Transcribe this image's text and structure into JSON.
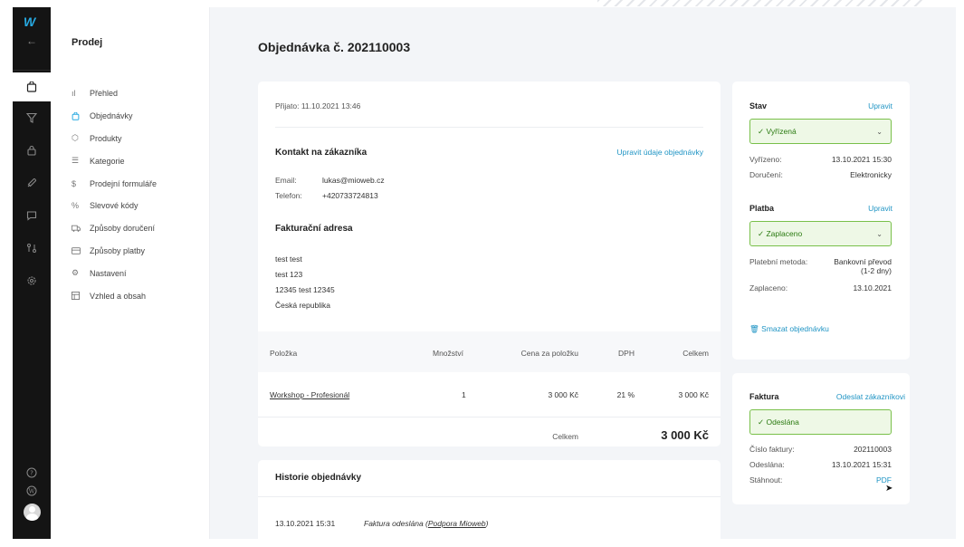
{
  "colors": {
    "accent": "#1f94c4",
    "rail": "#141414",
    "success_bg": "#eef8e6",
    "success_border": "#79c04a"
  },
  "rail": {
    "logo": "W",
    "icons": [
      "arrow-left-icon",
      "shopping-bag-icon",
      "filter-icon",
      "lock-icon",
      "rocket-icon",
      "chat-icon",
      "integrations-icon",
      "gear-icon",
      "help-icon",
      "wordpress-icon",
      "avatar"
    ]
  },
  "subnav": {
    "title": "Prodej",
    "items": [
      {
        "label": "Přehled",
        "icon": "chart-icon"
      },
      {
        "label": "Objednávky",
        "icon": "bag-icon"
      },
      {
        "label": "Produkty",
        "icon": "box-icon"
      },
      {
        "label": "Kategorie",
        "icon": "list-icon"
      },
      {
        "label": "Prodejní formuláře",
        "icon": "dollar-icon"
      },
      {
        "label": "Slevové kódy",
        "icon": "percent-icon"
      },
      {
        "label": "Způsoby doručení",
        "icon": "truck-icon"
      },
      {
        "label": "Způsoby platby",
        "icon": "card-icon"
      },
      {
        "label": "Nastavení",
        "icon": "gear-icon"
      },
      {
        "label": "Vzhled a obsah",
        "icon": "layout-icon"
      }
    ]
  },
  "page": {
    "title": "Objednávka č. 202110003"
  },
  "order": {
    "received": "Přijato: 11.10.2021 13:46",
    "contact_title": "Kontakt na zákazníka",
    "edit_link": "Upravit údaje objednávky",
    "email_label": "Email:",
    "email": "lukas@mioweb.cz",
    "phone_label": "Telefon:",
    "phone": "+420733724813",
    "billing_title": "Fakturační adresa",
    "address": [
      "test test",
      "test 123",
      "12345 test 12345",
      "Česká republika"
    ],
    "table": {
      "headers": [
        "Položka",
        "Množství",
        "Cena za položku",
        "DPH",
        "Celkem"
      ],
      "rows": [
        [
          "Workshop - Profesionál",
          "1",
          "3 000 Kč",
          "21 %",
          "3 000 Kč"
        ]
      ],
      "total_label": "Celkem",
      "total_value": "3 000 Kč"
    }
  },
  "history": {
    "title": "Historie objednávky",
    "entries": [
      {
        "time": "13.10.2021 15:31",
        "text": "Faktura odeslána (",
        "link": "Podpora Mioweb",
        "close": ")"
      }
    ]
  },
  "status": {
    "stav_title": "Stav",
    "stav_edit": "Upravit",
    "stav_value": "Vyřízená",
    "vyrizeno_label": "Vyřízeno:",
    "vyrizeno_value": "13.10.2021 15:30",
    "doruceni_label": "Doručení:",
    "doruceni_value": "Elektronicky",
    "platba_title": "Platba",
    "platba_edit": "Upravit",
    "platba_value": "Zaplaceno",
    "metoda_label": "Platební metoda:",
    "metoda_value_1": "Bankovní převod",
    "metoda_value_2": "(1-2 dny)",
    "zaplaceno_label": "Zaplaceno:",
    "zaplaceno_value": "13.10.2021",
    "delete": "Smazat objednávku"
  },
  "invoice": {
    "title": "Faktura",
    "send": "Odeslat zákazníkovi",
    "value": "Odeslána",
    "number_label": "Číslo faktury:",
    "number_value": "202110003",
    "sent_label": "Odeslána:",
    "sent_value": "13.10.2021 15:31",
    "download_label": "Stáhnout:",
    "download_value": "PDF"
  }
}
